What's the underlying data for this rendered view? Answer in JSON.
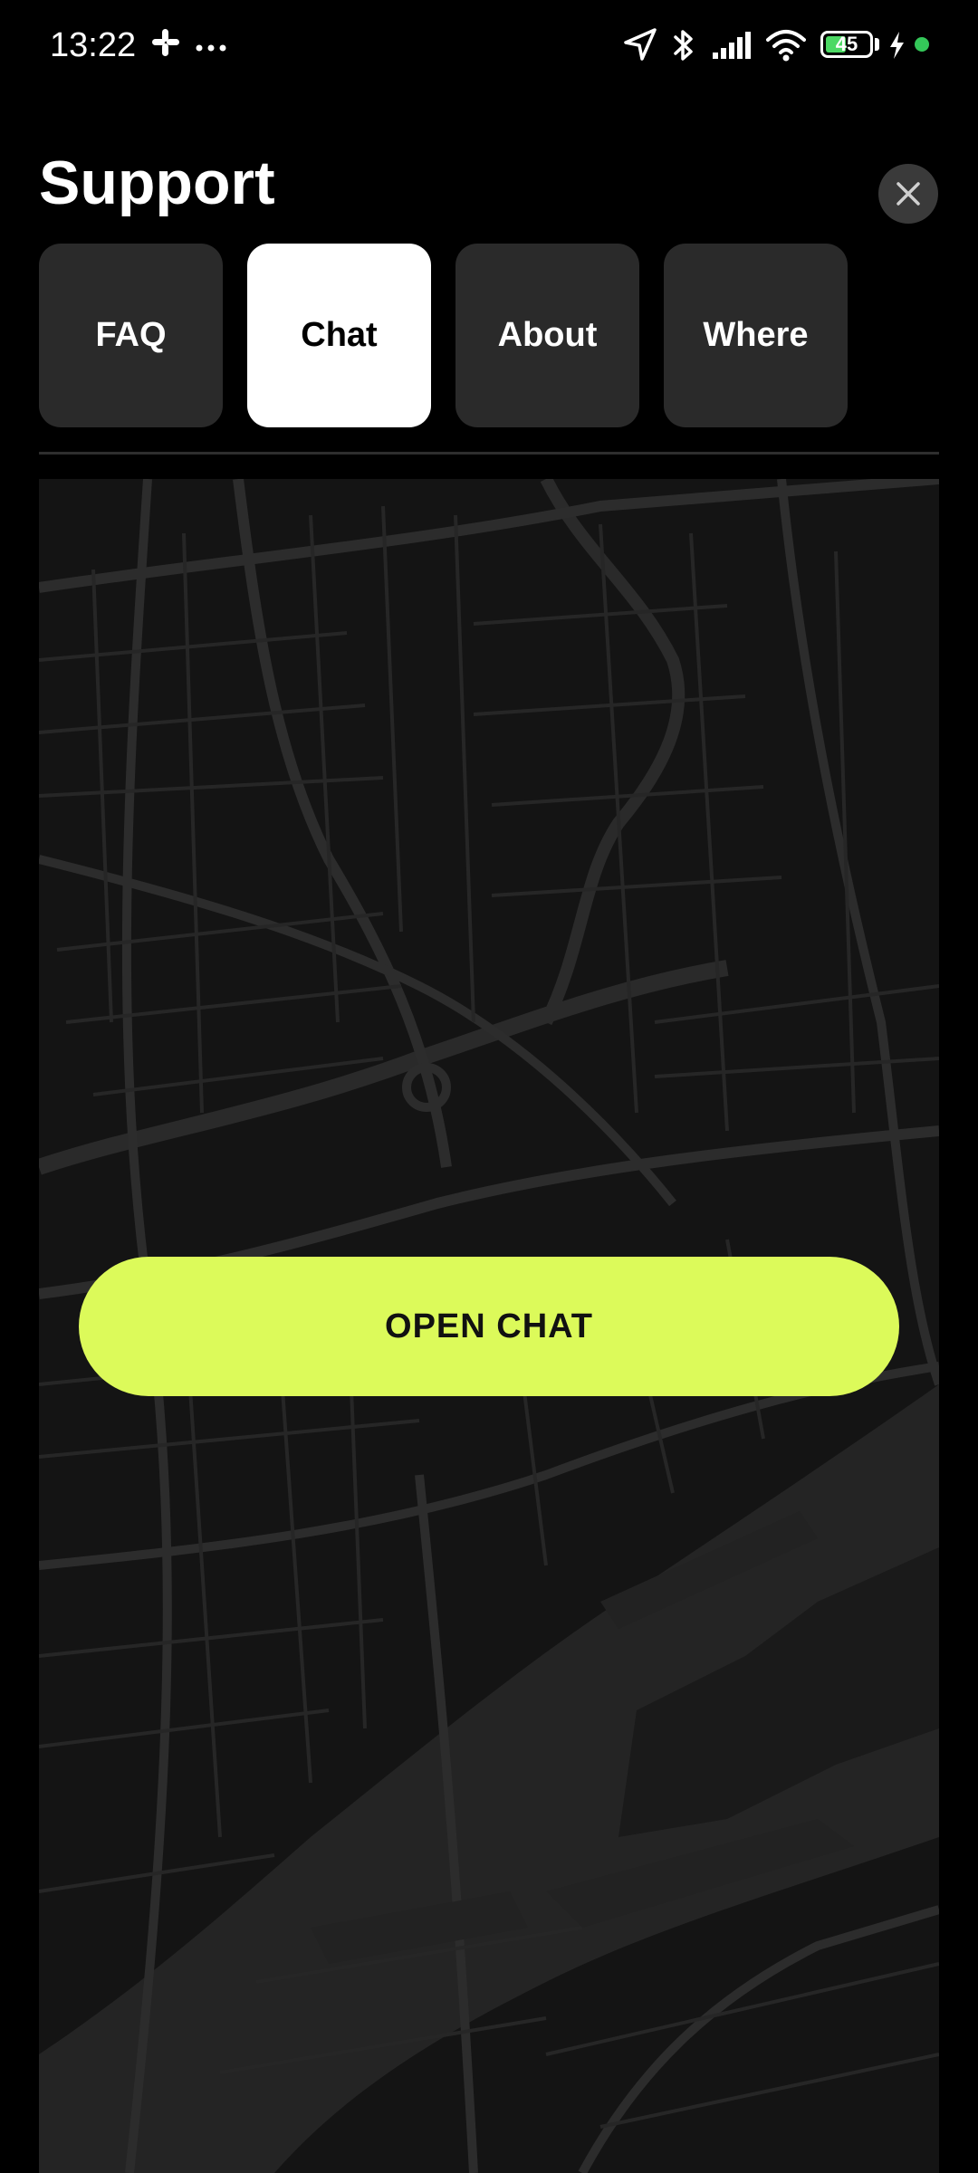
{
  "status_bar": {
    "time": "13:22",
    "battery_level": "45",
    "left_icons": [
      "slack-icon",
      "more-icon"
    ],
    "right_icons": [
      "location-arrow-icon",
      "bluetooth-icon",
      "signal-icon",
      "wifi-icon",
      "battery-icon",
      "charging-icon"
    ]
  },
  "header": {
    "title": "Support",
    "close_icon": "close-icon"
  },
  "tabs": [
    {
      "label": "FAQ",
      "active": false
    },
    {
      "label": "Chat",
      "active": true
    },
    {
      "label": "About",
      "active": false
    },
    {
      "label": "Where",
      "active": false
    }
  ],
  "main": {
    "background": "map",
    "cta_label": "OPEN CHAT"
  },
  "colors": {
    "background": "#000000",
    "tab_inactive": "#2a2a2a",
    "tab_active": "#ffffff",
    "accent": "#dcfa5a",
    "map_base": "#141414",
    "map_roads": "#2c2c2c"
  }
}
